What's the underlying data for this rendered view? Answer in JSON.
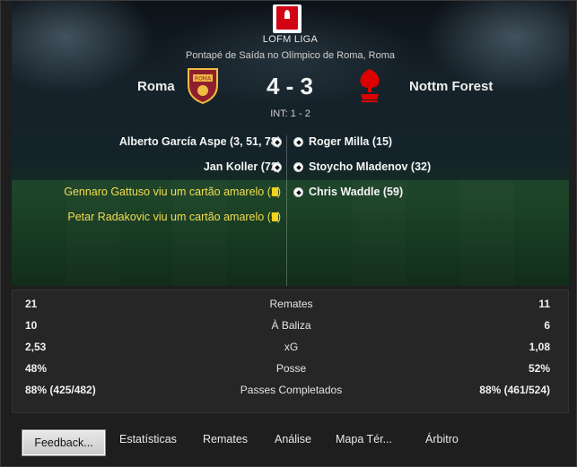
{
  "header": {
    "league_name": "LOFM LIGA",
    "venue": "Pontapé de Saída no Olímpico de Roma, Roma",
    "home_team": "Roma",
    "away_team": "Nottm Forest",
    "score": "4 - 3",
    "halftime": "INT: 1 - 2"
  },
  "events": {
    "home": [
      {
        "text": "Alberto García Aspe (3, 51, 78)",
        "icon": "ball-icon"
      },
      {
        "text": "Jan Koller (72)",
        "icon": "ball-icon"
      },
      {
        "text": "Gennaro Gattuso viu um cartão amarelo (2)",
        "icon": "yellow-card-icon"
      },
      {
        "text": "Petar Radakovic viu um cartão amarelo (5)",
        "icon": "yellow-card-icon"
      }
    ],
    "away": [
      {
        "text": "Roger Milla (15)",
        "icon": "ball-icon"
      },
      {
        "text": "Stoycho Mladenov (32)",
        "icon": "ball-icon"
      },
      {
        "text": "Chris Waddle (59)",
        "icon": "ball-icon"
      }
    ]
  },
  "stats": [
    {
      "home": "21",
      "label": "Remates",
      "away": "11"
    },
    {
      "home": "10",
      "label": "À Baliza",
      "away": "6"
    },
    {
      "home": "2,53",
      "label": "xG",
      "away": "1,08"
    },
    {
      "home": "48%",
      "label": "Posse",
      "away": "52%"
    },
    {
      "home": "88% (425/482)",
      "label": "Passes Completados",
      "away": "88% (461/524)"
    }
  ],
  "tabs": {
    "feedback": "Feedback...",
    "estatisticas": "Estatísticas",
    "remates": "Remates",
    "analise": "Análise",
    "mapa": "Mapa Tér...",
    "arbitro": "Árbitro"
  },
  "colors": {
    "yellow_event": "#f2dd4f",
    "roma_crest": "#8e1f2f",
    "roma_gold": "#f0bc42",
    "forest_red": "#dd0000"
  }
}
